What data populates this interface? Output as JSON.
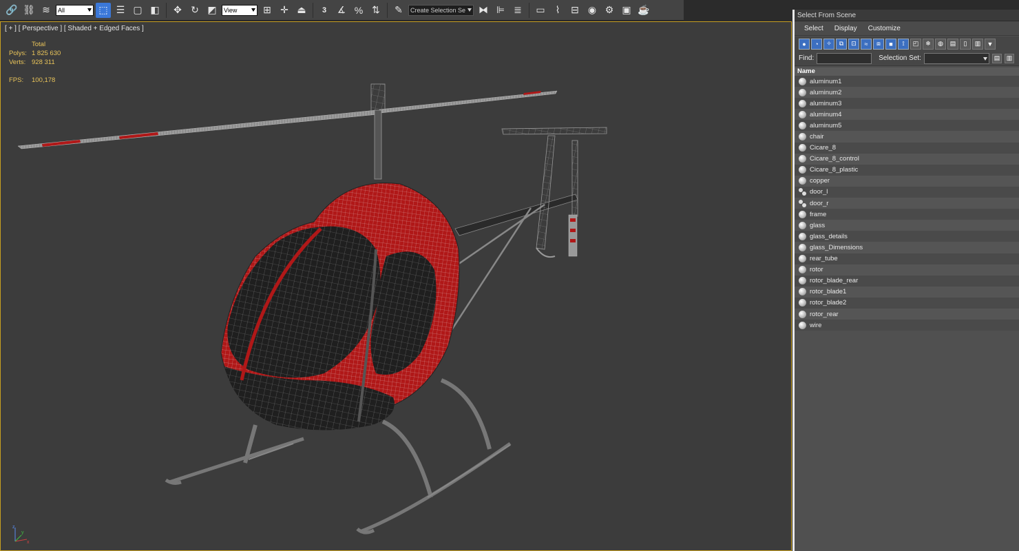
{
  "toolbar": {
    "selection_filter": "All",
    "reference_coord": "View",
    "snap_label": "3",
    "named_selection_placeholder": "Create Selection Se",
    "icons": [
      "link-icon",
      "unlink-icon",
      "bind-spacewarp-icon",
      "select-object-icon",
      "select-by-name-icon",
      "rect-region-icon",
      "window-crossing-icon",
      "move-icon",
      "rotate-icon",
      "scale-icon",
      "pivot-icon",
      "manipulate-icon",
      "angle-snap-icon",
      "percent-snap-icon",
      "spinner-snap-icon",
      "edit-named-sets-icon",
      "mirror-icon",
      "align-icon",
      "layer-icon",
      "graph-editor-icon",
      "schematic-icon",
      "material-editor-icon",
      "render-setup-icon",
      "render-frame-icon",
      "render-icon"
    ]
  },
  "viewport": {
    "label": "[ + ] [ Perspective ] [ Shaded + Edged Faces ]",
    "stats": {
      "header": "Total",
      "polys_label": "Polys:",
      "polys_value": "1 825 630",
      "verts_label": "Verts:",
      "verts_value": "928 311",
      "fps_label": "FPS:",
      "fps_value": "100,178"
    },
    "axis": {
      "x": "x",
      "y": "y",
      "z": "z"
    }
  },
  "scene_panel": {
    "title": "Select From Scene",
    "menu": [
      "Select",
      "Display",
      "Customize"
    ],
    "find_label": "Find:",
    "selection_set_label": "Selection Set:",
    "column_header": "Name",
    "objects": [
      {
        "name": "aluminum1",
        "type": "object"
      },
      {
        "name": "aluminum2",
        "type": "object"
      },
      {
        "name": "aluminum3",
        "type": "object"
      },
      {
        "name": "aluminum4",
        "type": "object"
      },
      {
        "name": "aluminum5",
        "type": "object"
      },
      {
        "name": "chair",
        "type": "object"
      },
      {
        "name": "Cicare_8",
        "type": "object"
      },
      {
        "name": "Cicare_8_control",
        "type": "object"
      },
      {
        "name": "Cicare_8_plastic",
        "type": "object"
      },
      {
        "name": "copper",
        "type": "object"
      },
      {
        "name": "door_l",
        "type": "group"
      },
      {
        "name": "door_r",
        "type": "group"
      },
      {
        "name": "frame",
        "type": "object"
      },
      {
        "name": "glass",
        "type": "object"
      },
      {
        "name": "glass_details",
        "type": "object"
      },
      {
        "name": "glass_Dimensions",
        "type": "object"
      },
      {
        "name": "rear_tube",
        "type": "object"
      },
      {
        "name": "rotor",
        "type": "object"
      },
      {
        "name": "rotor_blade_rear",
        "type": "object"
      },
      {
        "name": "rotor_blade1",
        "type": "object"
      },
      {
        "name": "rotor_blade2",
        "type": "object"
      },
      {
        "name": "rotor_rear",
        "type": "object"
      },
      {
        "name": "wire",
        "type": "object"
      }
    ]
  },
  "colors": {
    "viewport_bg": "#3c3c3c",
    "stats_text": "#e9c45a",
    "active_viewport_border": "#c8a020",
    "body_red": "#b01818",
    "selection_blue": "#3b78d8"
  }
}
